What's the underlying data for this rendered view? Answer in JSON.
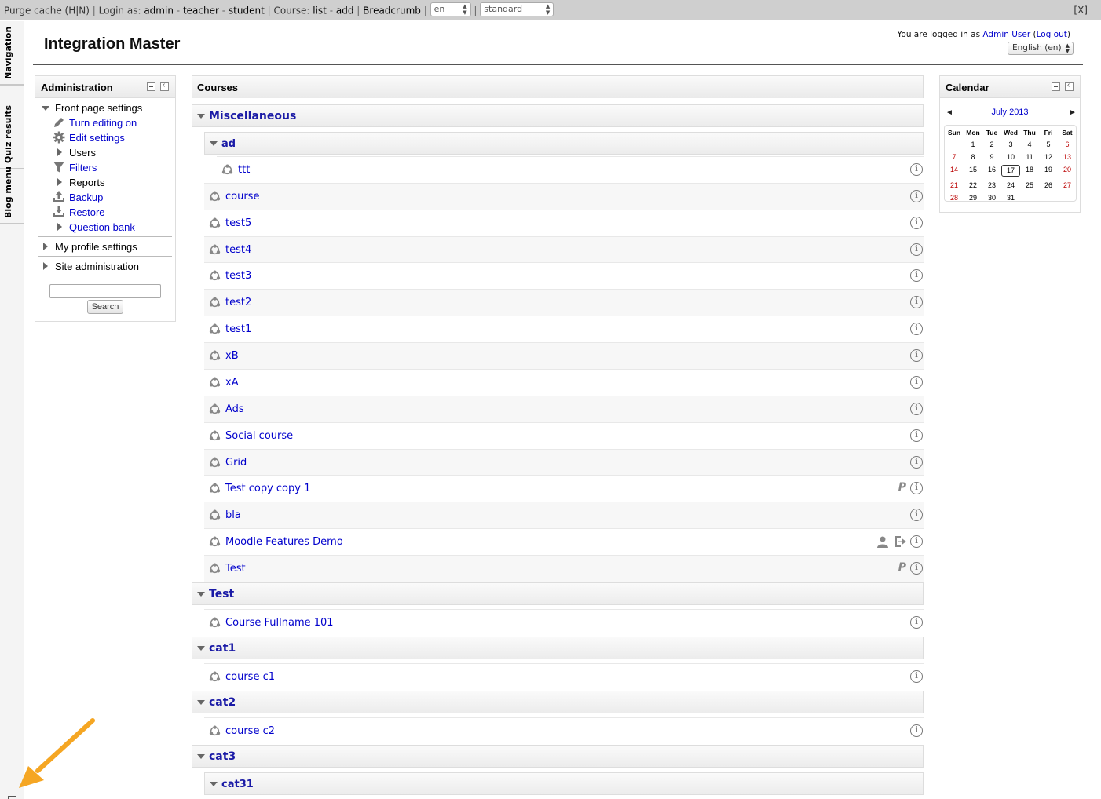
{
  "devbar": {
    "purge": "Purge cache",
    "hn": "(H|N)",
    "login_as": "Login as:",
    "admin": "admin",
    "teacher": "teacher",
    "student": "student",
    "course": "Course:",
    "list": "list",
    "add": "add",
    "breadcrumb": "Breadcrumb",
    "lang_value": "en",
    "theme_value": "standard",
    "close": "[X]"
  },
  "dock": {
    "tabs": [
      "Navigation",
      "Quiz results",
      "Blog menu"
    ]
  },
  "header": {
    "site_title": "Integration Master",
    "logged_in_prefix": "You are logged in as",
    "user_name": "Admin User",
    "logout": "Log out",
    "language": "English (en)"
  },
  "admin_block": {
    "title": "Administration",
    "front_page_settings": "Front page settings",
    "items": [
      "Turn editing on",
      "Edit settings",
      "Users",
      "Filters",
      "Reports",
      "Backup",
      "Restore",
      "Question bank"
    ],
    "my_profile_settings": "My profile settings",
    "site_administration": "Site administration",
    "search_button": "Search"
  },
  "courses_block": {
    "title": "Courses",
    "categories": [
      {
        "name": "Miscellaneous"
      },
      {
        "name": "ad"
      },
      {
        "name": "Test"
      },
      {
        "name": "cat1"
      },
      {
        "name": "cat2"
      },
      {
        "name": "cat3"
      },
      {
        "name": "cat31"
      }
    ],
    "courses": [
      "ttt",
      "course",
      "test5",
      "test4",
      "test3",
      "test2",
      "test1",
      "xB",
      "xA",
      "Ads",
      "Social course",
      "Grid",
      "Test copy copy 1",
      "bla",
      "Moodle Features Demo",
      "Test",
      "Course Fullname 101",
      "course c1",
      "course c2"
    ],
    "info_glyph": "i",
    "paypal_glyph": "P"
  },
  "calendar": {
    "title": "Calendar",
    "month": "July 2013",
    "prev": "◄",
    "next": "►",
    "weekdays": [
      "Sun",
      "Mon",
      "Tue",
      "Wed",
      "Thu",
      "Fri",
      "Sat"
    ],
    "weeks": [
      [
        "",
        "1",
        "2",
        "3",
        "4",
        "5",
        "6"
      ],
      [
        "7",
        "8",
        "9",
        "10",
        "11",
        "12",
        "13"
      ],
      [
        "14",
        "15",
        "16",
        "17",
        "18",
        "19",
        "20"
      ],
      [
        "21",
        "22",
        "23",
        "24",
        "25",
        "26",
        "27"
      ],
      [
        "28",
        "29",
        "30",
        "31",
        "",
        "",
        ""
      ]
    ],
    "today": "17",
    "weekend_color": "#bb0000"
  },
  "colors": {
    "link": "#0000cc",
    "category": "#1a1aa6",
    "devbar": "#cfcfcf",
    "arrow": "#f5a623"
  }
}
